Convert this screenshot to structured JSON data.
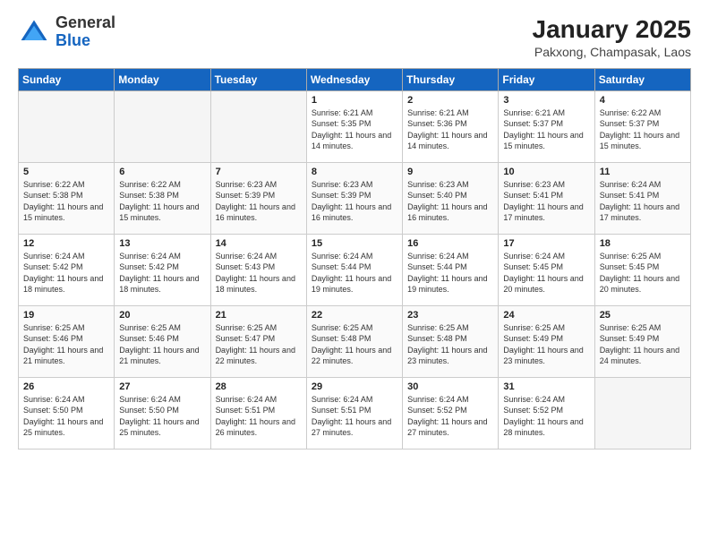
{
  "logo": {
    "general": "General",
    "blue": "Blue"
  },
  "header": {
    "month_year": "January 2025",
    "location": "Pakxong, Champasak, Laos"
  },
  "days_of_week": [
    "Sunday",
    "Monday",
    "Tuesday",
    "Wednesday",
    "Thursday",
    "Friday",
    "Saturday"
  ],
  "weeks": [
    [
      {
        "day": "",
        "info": ""
      },
      {
        "day": "",
        "info": ""
      },
      {
        "day": "",
        "info": ""
      },
      {
        "day": "1",
        "info": "Sunrise: 6:21 AM\nSunset: 5:35 PM\nDaylight: 11 hours and 14 minutes."
      },
      {
        "day": "2",
        "info": "Sunrise: 6:21 AM\nSunset: 5:36 PM\nDaylight: 11 hours and 14 minutes."
      },
      {
        "day": "3",
        "info": "Sunrise: 6:21 AM\nSunset: 5:37 PM\nDaylight: 11 hours and 15 minutes."
      },
      {
        "day": "4",
        "info": "Sunrise: 6:22 AM\nSunset: 5:37 PM\nDaylight: 11 hours and 15 minutes."
      }
    ],
    [
      {
        "day": "5",
        "info": "Sunrise: 6:22 AM\nSunset: 5:38 PM\nDaylight: 11 hours and 15 minutes."
      },
      {
        "day": "6",
        "info": "Sunrise: 6:22 AM\nSunset: 5:38 PM\nDaylight: 11 hours and 15 minutes."
      },
      {
        "day": "7",
        "info": "Sunrise: 6:23 AM\nSunset: 5:39 PM\nDaylight: 11 hours and 16 minutes."
      },
      {
        "day": "8",
        "info": "Sunrise: 6:23 AM\nSunset: 5:39 PM\nDaylight: 11 hours and 16 minutes."
      },
      {
        "day": "9",
        "info": "Sunrise: 6:23 AM\nSunset: 5:40 PM\nDaylight: 11 hours and 16 minutes."
      },
      {
        "day": "10",
        "info": "Sunrise: 6:23 AM\nSunset: 5:41 PM\nDaylight: 11 hours and 17 minutes."
      },
      {
        "day": "11",
        "info": "Sunrise: 6:24 AM\nSunset: 5:41 PM\nDaylight: 11 hours and 17 minutes."
      }
    ],
    [
      {
        "day": "12",
        "info": "Sunrise: 6:24 AM\nSunset: 5:42 PM\nDaylight: 11 hours and 18 minutes."
      },
      {
        "day": "13",
        "info": "Sunrise: 6:24 AM\nSunset: 5:42 PM\nDaylight: 11 hours and 18 minutes."
      },
      {
        "day": "14",
        "info": "Sunrise: 6:24 AM\nSunset: 5:43 PM\nDaylight: 11 hours and 18 minutes."
      },
      {
        "day": "15",
        "info": "Sunrise: 6:24 AM\nSunset: 5:44 PM\nDaylight: 11 hours and 19 minutes."
      },
      {
        "day": "16",
        "info": "Sunrise: 6:24 AM\nSunset: 5:44 PM\nDaylight: 11 hours and 19 minutes."
      },
      {
        "day": "17",
        "info": "Sunrise: 6:24 AM\nSunset: 5:45 PM\nDaylight: 11 hours and 20 minutes."
      },
      {
        "day": "18",
        "info": "Sunrise: 6:25 AM\nSunset: 5:45 PM\nDaylight: 11 hours and 20 minutes."
      }
    ],
    [
      {
        "day": "19",
        "info": "Sunrise: 6:25 AM\nSunset: 5:46 PM\nDaylight: 11 hours and 21 minutes."
      },
      {
        "day": "20",
        "info": "Sunrise: 6:25 AM\nSunset: 5:46 PM\nDaylight: 11 hours and 21 minutes."
      },
      {
        "day": "21",
        "info": "Sunrise: 6:25 AM\nSunset: 5:47 PM\nDaylight: 11 hours and 22 minutes."
      },
      {
        "day": "22",
        "info": "Sunrise: 6:25 AM\nSunset: 5:48 PM\nDaylight: 11 hours and 22 minutes."
      },
      {
        "day": "23",
        "info": "Sunrise: 6:25 AM\nSunset: 5:48 PM\nDaylight: 11 hours and 23 minutes."
      },
      {
        "day": "24",
        "info": "Sunrise: 6:25 AM\nSunset: 5:49 PM\nDaylight: 11 hours and 23 minutes."
      },
      {
        "day": "25",
        "info": "Sunrise: 6:25 AM\nSunset: 5:49 PM\nDaylight: 11 hours and 24 minutes."
      }
    ],
    [
      {
        "day": "26",
        "info": "Sunrise: 6:24 AM\nSunset: 5:50 PM\nDaylight: 11 hours and 25 minutes."
      },
      {
        "day": "27",
        "info": "Sunrise: 6:24 AM\nSunset: 5:50 PM\nDaylight: 11 hours and 25 minutes."
      },
      {
        "day": "28",
        "info": "Sunrise: 6:24 AM\nSunset: 5:51 PM\nDaylight: 11 hours and 26 minutes."
      },
      {
        "day": "29",
        "info": "Sunrise: 6:24 AM\nSunset: 5:51 PM\nDaylight: 11 hours and 27 minutes."
      },
      {
        "day": "30",
        "info": "Sunrise: 6:24 AM\nSunset: 5:52 PM\nDaylight: 11 hours and 27 minutes."
      },
      {
        "day": "31",
        "info": "Sunrise: 6:24 AM\nSunset: 5:52 PM\nDaylight: 11 hours and 28 minutes."
      },
      {
        "day": "",
        "info": ""
      }
    ]
  ]
}
